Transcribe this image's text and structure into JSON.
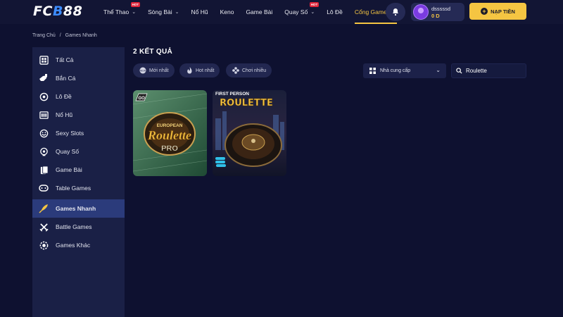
{
  "header": {
    "logo_fc": "FC",
    "logo_b": "B",
    "logo_88": "88",
    "nav": [
      {
        "label": "Thể Thao",
        "chevron": true,
        "hot": "HOT"
      },
      {
        "label": "Sòng Bài",
        "chevron": true
      },
      {
        "label": "Nổ Hũ"
      },
      {
        "label": "Keno"
      },
      {
        "label": "Game Bài"
      },
      {
        "label": "Quay Số",
        "chevron": true,
        "hot": "HOT"
      },
      {
        "label": "Lô Đề"
      },
      {
        "label": "Cổng Games",
        "chevron": true,
        "active": true
      }
    ],
    "username": "dsssssd",
    "balance": "0 D",
    "deposit_label": "NẠP TIỀN"
  },
  "breadcrumb": {
    "home": "Trang Chủ",
    "separator": "/",
    "current": "Games Nhanh"
  },
  "sidebar": {
    "items": [
      {
        "label": "Tất Cả",
        "icon": "grid-icon"
      },
      {
        "label": "Bắn Cá",
        "icon": "fish-icon"
      },
      {
        "label": "Lô Đề",
        "icon": "lottery-ball-icon"
      },
      {
        "label": "Nổ Hũ",
        "icon": "slot-machine-icon"
      },
      {
        "label": "Sexy Slots",
        "icon": "face-icon"
      },
      {
        "label": "Quay Số",
        "icon": "spin-icon"
      },
      {
        "label": "Game Bài",
        "icon": "cards-icon"
      },
      {
        "label": "Table Games",
        "icon": "table-icon"
      },
      {
        "label": "Games Nhanh",
        "icon": "rocket-icon",
        "active": true
      },
      {
        "label": "Battle Games",
        "icon": "swords-icon"
      },
      {
        "label": "Games Khác",
        "icon": "chip-icon"
      }
    ]
  },
  "main": {
    "results": "2 KẾT QUẢ",
    "filters": [
      {
        "label": "Mới nhất",
        "icon": "new-icon"
      },
      {
        "label": "Hot nhất",
        "icon": "fire-icon"
      },
      {
        "label": "Chơi nhiều",
        "icon": "gamepad-icon"
      }
    ],
    "provider_label": "Nhà cung cấp",
    "search_value": "Roulette",
    "games": [
      {
        "title_top": "EUROPEAN",
        "title_main": "Roulette",
        "title_sub": "PRO",
        "badge": "GO"
      },
      {
        "title_top": "FIRST PERSON",
        "title_main": "ROULETTE"
      }
    ]
  },
  "colors": {
    "accent": "#f5c542",
    "background": "#0e1130",
    "sidebar": "#1a2046",
    "sidebar_active": "#2b3b7b",
    "hot": "#e0243a"
  }
}
